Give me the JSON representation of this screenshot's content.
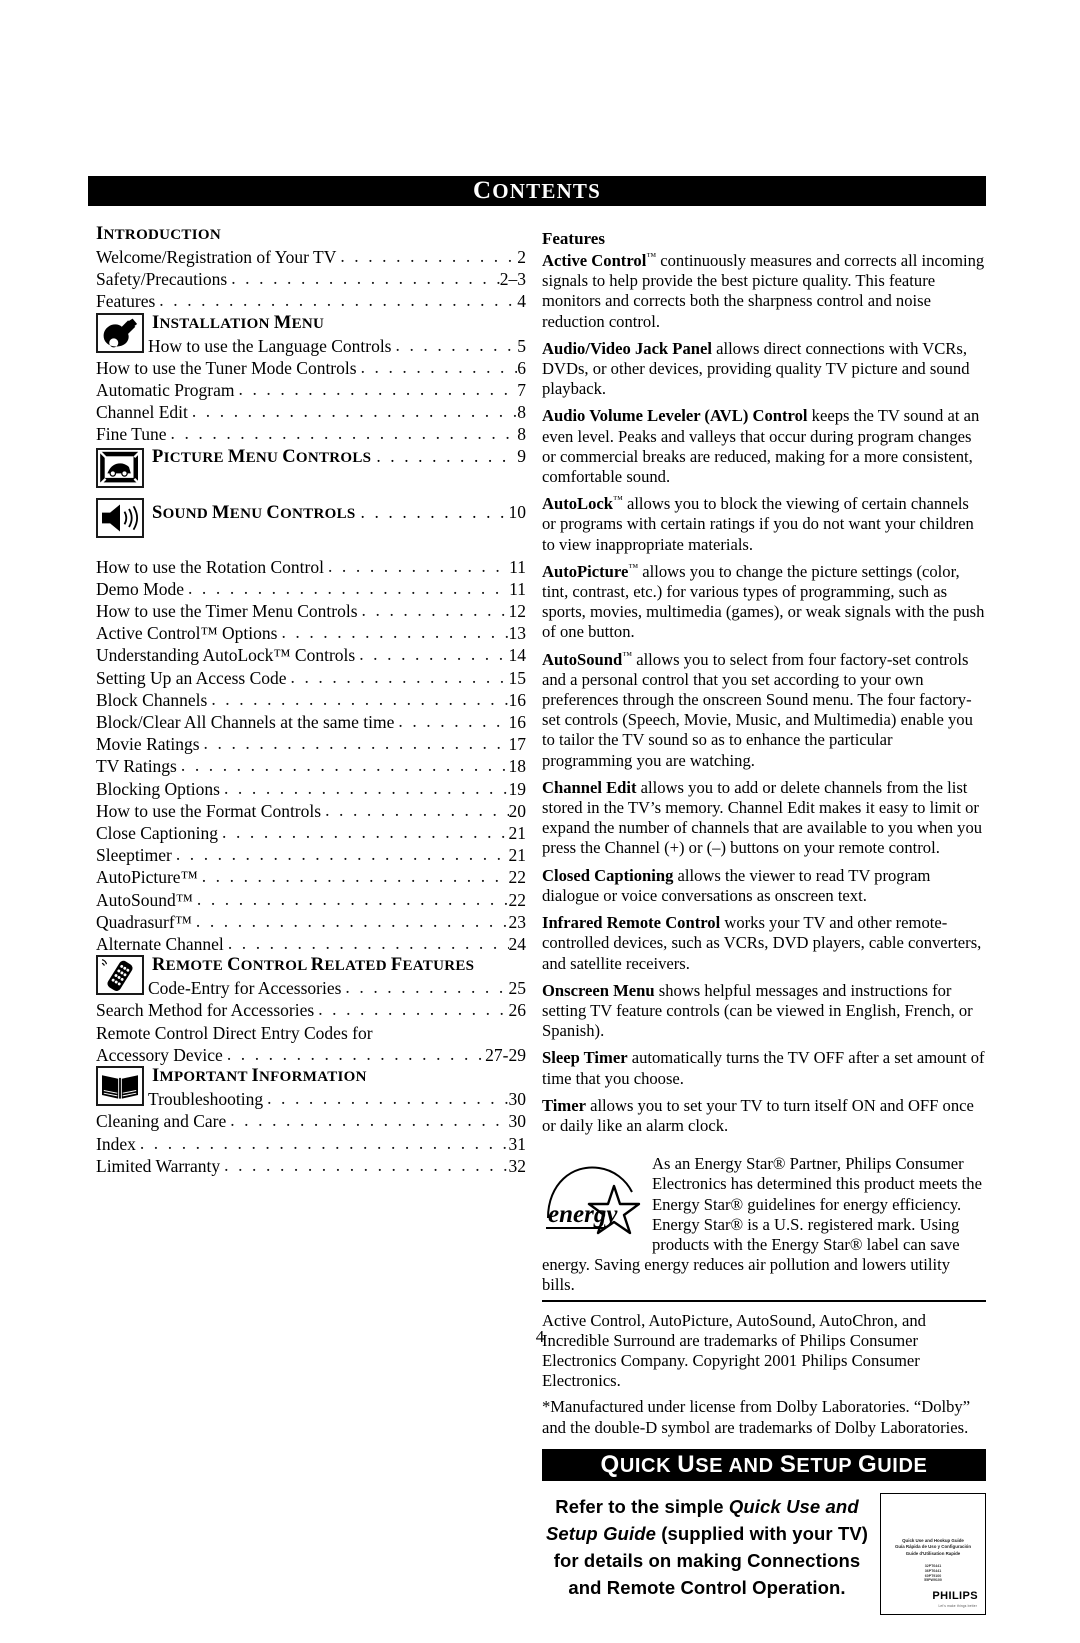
{
  "header": {
    "title_cap": "C",
    "title_rest": "ONTENTS"
  },
  "toc": {
    "sections": [
      {
        "heading_cap": "I",
        "heading_rest": "NTRODUCTION",
        "icon": null,
        "entries": [
          {
            "label": "Welcome/Registration of Your TV",
            "page": "2"
          },
          {
            "label": "Safety/Precautions",
            "page": "2–3"
          },
          {
            "label": "Features",
            "page": "4"
          }
        ]
      },
      {
        "heading_cap": "I",
        "heading_rest": "NSTALLATION ",
        "heading_cap2": "M",
        "heading_rest2": "ENU",
        "icon": "wrench-icon",
        "icon_first_entry": {
          "label": "How to use the Language Controls",
          "page": "5"
        },
        "entries": [
          {
            "label": "How to use the Tuner Mode Controls",
            "page": "6"
          },
          {
            "label": "Automatic Program",
            "page": "7"
          },
          {
            "label": "Channel Edit",
            "page": "8"
          },
          {
            "label": "Fine Tune",
            "page": "8"
          }
        ]
      },
      {
        "heading_cap": "P",
        "heading_rest": "ICTURE ",
        "heading_cap2": "M",
        "heading_rest2": "ENU ",
        "heading_cap3": "C",
        "heading_rest3": "ONTROLS",
        "icon": "picture-menu-icon",
        "heading_page": "9",
        "entries": []
      },
      {
        "heading_cap": "S",
        "heading_rest": "OUND ",
        "heading_cap2": "M",
        "heading_rest2": "ENU ",
        "heading_cap3": "C",
        "heading_rest3": "ONTROLS",
        "icon": "sound-menu-icon",
        "heading_page": "10",
        "entries": []
      },
      {
        "icon": null,
        "entries": [
          {
            "label": "How to use the Rotation Control",
            "page": "11"
          },
          {
            "label": "Demo Mode",
            "page": "11"
          },
          {
            "label": "How to use the Timer Menu Controls",
            "page": "12"
          },
          {
            "label": "Active Control™ Options",
            "page": "13"
          },
          {
            "label": "Understanding AutoLock™ Controls",
            "page": "14"
          },
          {
            "label": "Setting Up an Access Code",
            "page": "15"
          },
          {
            "label": "Block Channels",
            "page": "16"
          },
          {
            "label": "Block/Clear All Channels at the same time",
            "page": "16"
          },
          {
            "label": "Movie Ratings",
            "page": "17"
          },
          {
            "label": "TV Ratings",
            "page": "18"
          },
          {
            "label": "Blocking Options",
            "page": "19"
          },
          {
            "label": "How to use the Format Controls",
            "page": "20"
          },
          {
            "label": "Close Captioning",
            "page": "21"
          },
          {
            "label": "Sleeptimer",
            "page": "21"
          },
          {
            "label": "AutoPicture™",
            "page": "22"
          },
          {
            "label": "AutoSound™",
            "page": "22"
          },
          {
            "label": "Quadrasurf™",
            "page": "23"
          },
          {
            "label": "Alternate Channel",
            "page": "24"
          }
        ]
      },
      {
        "heading_cap": "R",
        "heading_rest": "EMOTE ",
        "heading_cap2": "C",
        "heading_rest2": "ONTROL ",
        "heading_cap3": "R",
        "heading_rest3": "ELATED ",
        "heading_cap4": "F",
        "heading_rest4": "EATURES",
        "icon": "remote-control-icon",
        "icon_first_entry": {
          "label": "Code-Entry for Accessories",
          "page": "25"
        },
        "entries": [
          {
            "label": "Search Method for Accessories",
            "page": "26"
          },
          {
            "label": "Remote Control Direct Entry Codes for",
            "page": "",
            "noleader": true
          },
          {
            "label": "Accessory Device",
            "page": "27-29"
          }
        ]
      },
      {
        "heading_cap": "I",
        "heading_rest": "MPORTANT ",
        "heading_cap2": "I",
        "heading_rest2": "NFORMATION",
        "icon": "book-icon",
        "icon_first_entry": {
          "label": "Troubleshooting",
          "page": "30"
        },
        "entries": [
          {
            "label": "Cleaning and Care",
            "page": "30"
          },
          {
            "label": "Index",
            "page": "31"
          },
          {
            "label": "Limited Warranty",
            "page": "32"
          }
        ]
      }
    ]
  },
  "features": {
    "heading": "Features",
    "items": [
      {
        "term": "Active Control",
        "tm": "™",
        "body": " continuously measures and corrects all incoming signals to help provide the best picture quality. This feature monitors and corrects both the sharpness control and noise reduction control."
      },
      {
        "term": "Audio/Video Jack Panel",
        "tm": "",
        "body": "  allows direct connections with VCRs, DVDs, or other devices, providing quality TV picture and sound playback."
      },
      {
        "term": "Audio Volume Leveler (AVL) Control",
        "tm": "",
        "body": " keeps the TV sound at an even level.  Peaks and valleys that occur during program changes or commercial breaks are reduced, making for a more consistent, comfortable sound."
      },
      {
        "term": "AutoLock",
        "tm": "™",
        "body": " allows you to block the viewing of certain channels or programs with certain ratings if you do not want your children to view inappropriate materials."
      },
      {
        "term": "AutoPicture",
        "tm": "™",
        "body": " allows you to change the picture settings (color, tint, contrast, etc.) for various types of programming, such as sports, movies, multimedia (games), or weak signals with the push of one button."
      },
      {
        "term": "AutoSound",
        "tm": "™",
        "body": " allows you to select from four factory-set controls and a personal control that you set according to your own preferences through the onscreen Sound menu. The four factory-set controls (Speech, Movie, Music, and Multimedia) enable you to tailor the TV sound so as to enhance the particular programming you are watching."
      },
      {
        "term": "Channel Edit",
        "tm": "",
        "body": " allows you to add or delete channels from the list stored in the TV’s memory.  Channel Edit makes it easy to limit or expand the number of channels that are available to you when you press the Channel (+) or (–) buttons on your remote control."
      },
      {
        "term": "Closed Captioning",
        "tm": "",
        "body": " allows the viewer to read TV program dialogue or voice conversations as onscreen text."
      },
      {
        "term": "Infrared Remote Control",
        "tm": "",
        "body": " works your  TV and other remote-controlled devices, such as VCRs, DVD players, cable converters, and satellite receivers."
      },
      {
        "term": "Onscreen Menu",
        "tm": "",
        "body": " shows helpful messages and instructions for setting TV feature controls (can be viewed in English, French, or Spanish)."
      },
      {
        "term": "Sleep Timer",
        "tm": "",
        "body": " automatically turns the TV OFF after a set amount of time that you choose."
      },
      {
        "term": "Timer",
        "tm": "",
        "body": " allows you to set your TV to turn itself ON and OFF once or daily like an alarm clock."
      }
    ]
  },
  "energy_star": {
    "logo_word": "energy",
    "text": "As an Energy Star® Partner, Philips Consumer Electronics has determined this product meets the Energy Star® guidelines for energy efficiency. Energy Star® is a U.S. registered mark. Using products with the Energy Star® label can save energy. Saving energy reduces air pollution and lowers utility bills."
  },
  "legal": {
    "trademark": "Active Control,  AutoPicture, AutoSound, AutoChron, and Incredible Surround are trademarks of Philips Consumer Electronics Company. Copyright 2001 Philips Consumer Electronics.",
    "dolby": "*Manufactured under license from Dolby Laboratories. “Dolby” and the double-D symbol are trademarks of Dolby Laboratories."
  },
  "quick_guide": {
    "title_parts": [
      {
        "cap": "Q",
        "rest": "UICK "
      },
      {
        "cap": "U",
        "rest": "SE AND "
      },
      {
        "cap": "S",
        "rest": "ETUP "
      },
      {
        "cap": "G",
        "rest": "UIDE"
      }
    ],
    "message_line1_a": "Refer to the simple ",
    "message_line1_b": "Quick Use and",
    "message_line2_a": "Setup Guide",
    "message_line2_b": " (supplied with your TV)",
    "message_line3": "for details on  making Connections",
    "message_line4": "and Remote Control Operation.",
    "booklet": {
      "line_en": "Quick Use and Hookup Guide",
      "line_es": "Guía Rápida de Uso y Configuración",
      "line_fr": "Guide d'Utilisation Rapide",
      "models": [
        "32PT6441",
        "36PT6441",
        "60PT9100",
        "55PW9100"
      ],
      "brand": "PHILIPS",
      "sub": "Let's make things better"
    }
  },
  "page_number": "4"
}
